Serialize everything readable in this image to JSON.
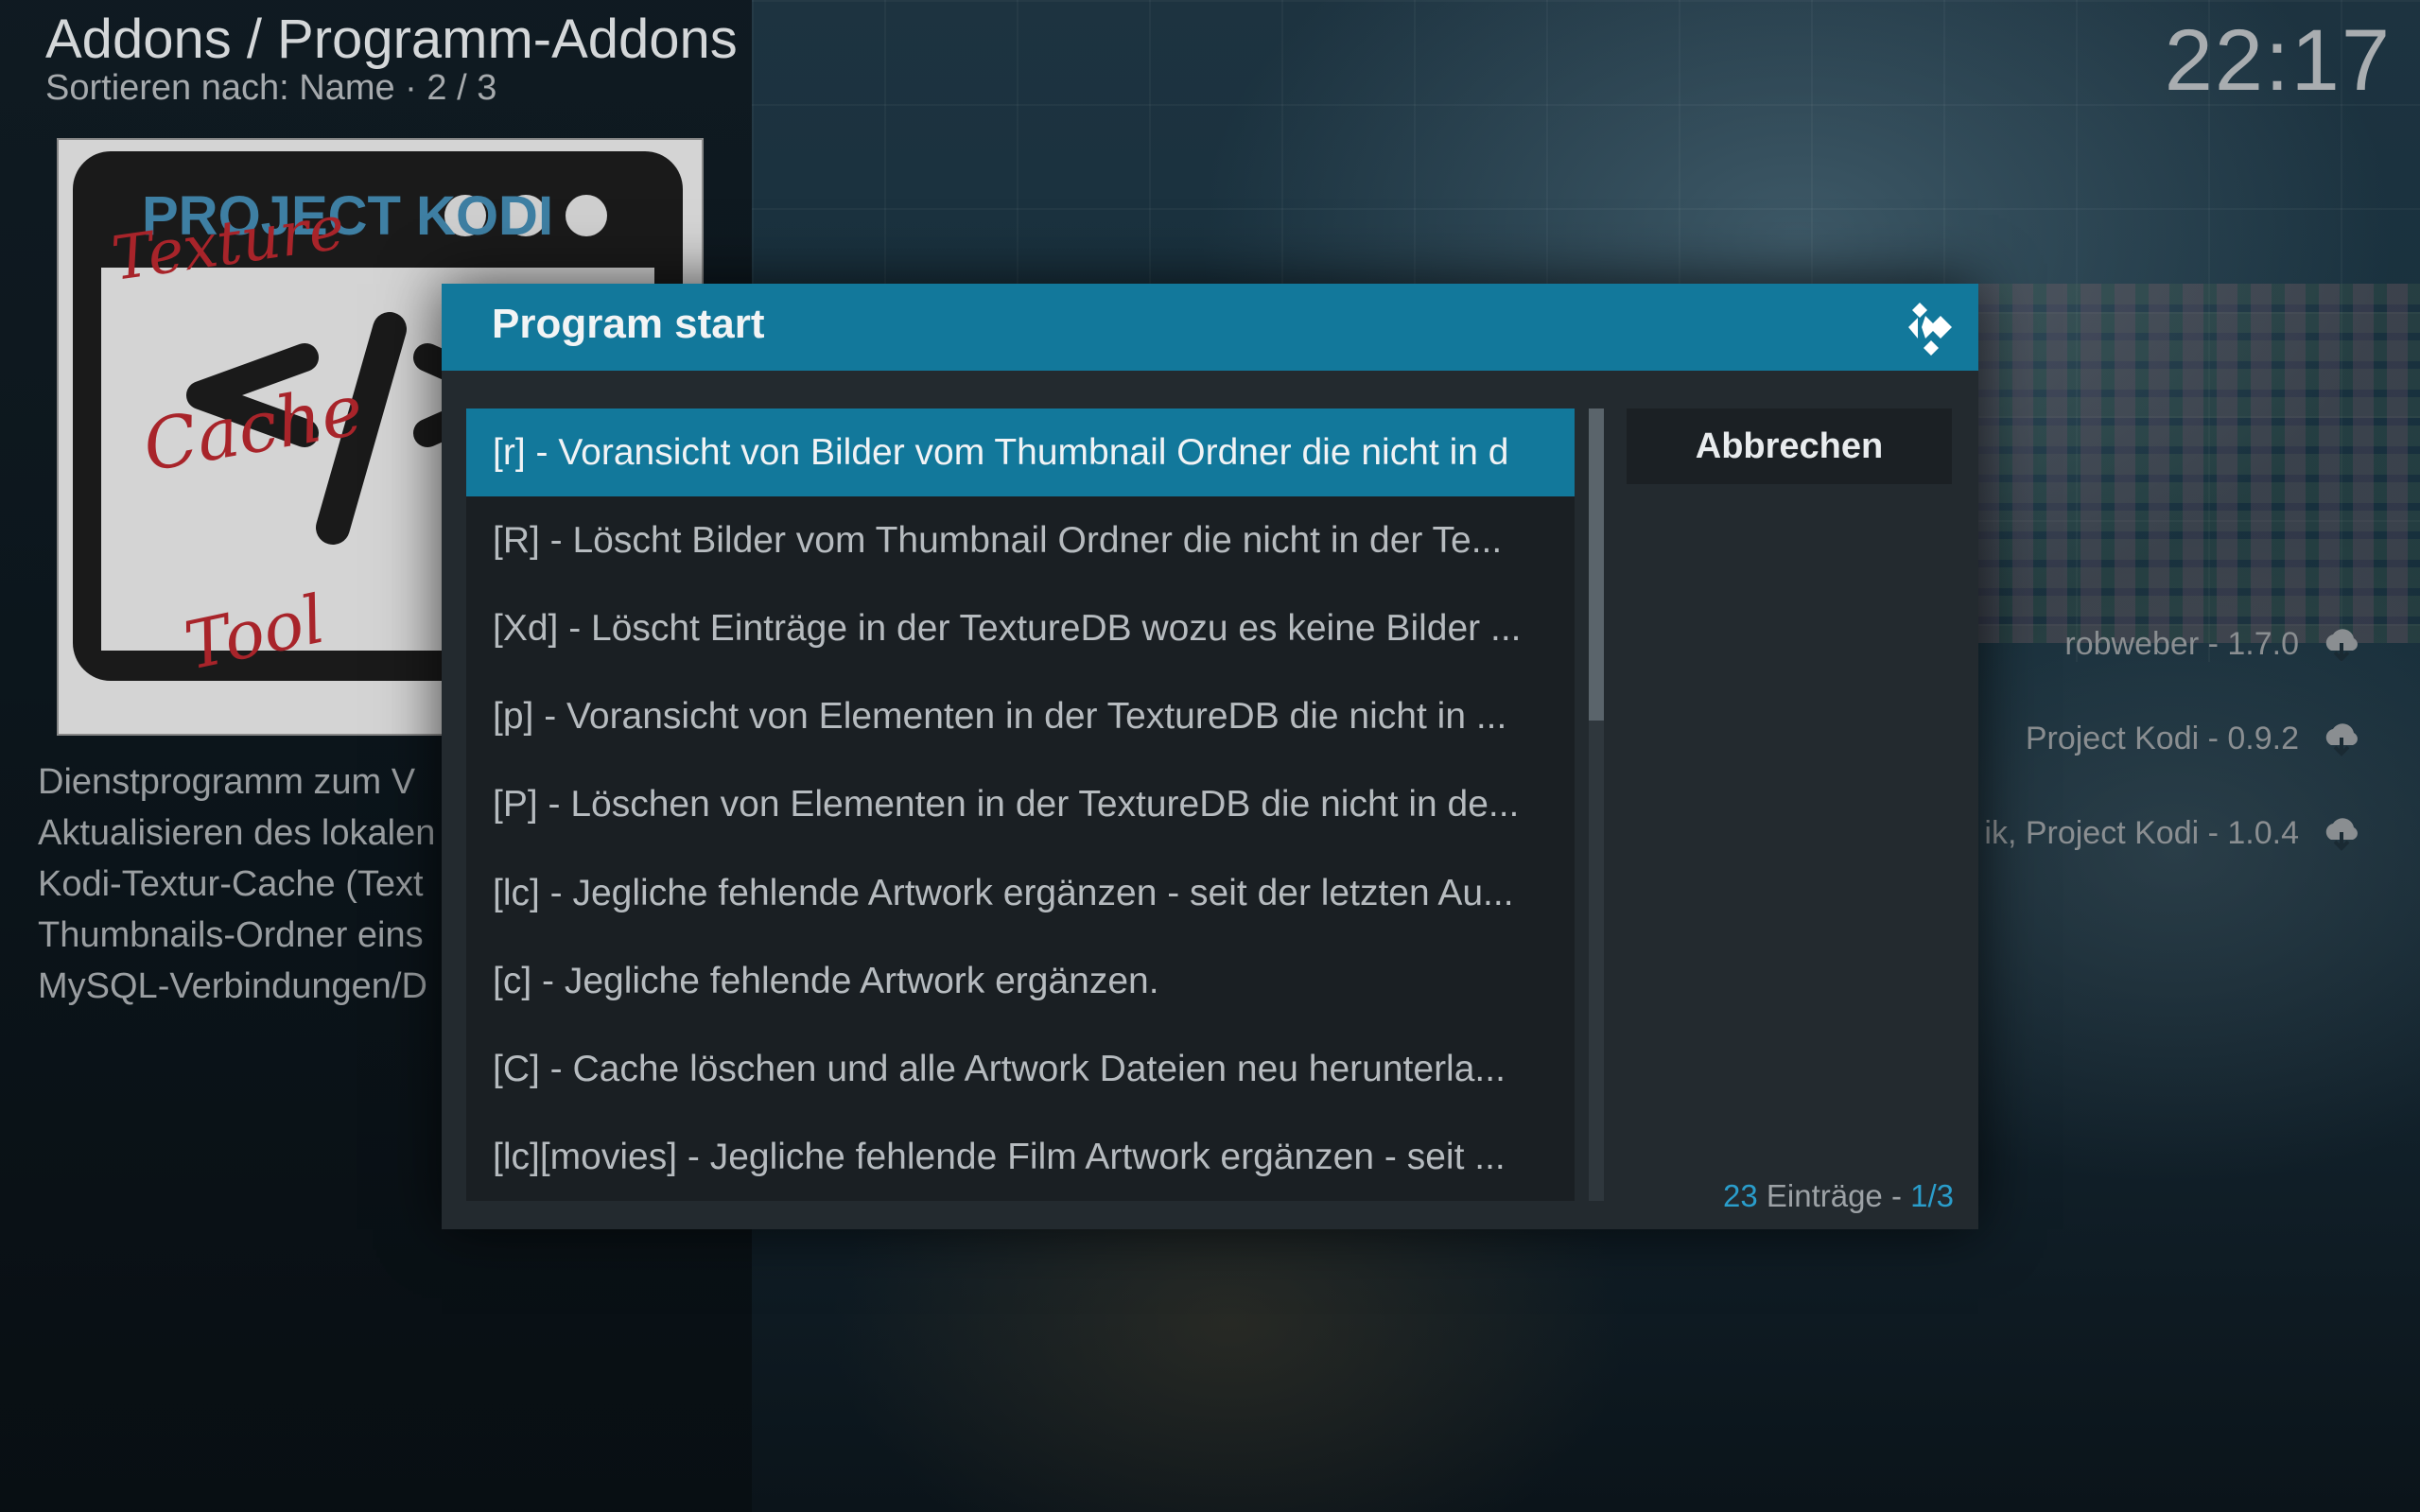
{
  "header": {
    "title": "Addons / Programm-Addons",
    "subtitle": "Sortieren nach: Name  ·  2 / 3",
    "clock": "22:17"
  },
  "addon_thumbnail": {
    "line1": "PROJECT KODI",
    "line2": "Texture",
    "line3": "Cache",
    "line4": "Tool"
  },
  "description": [
    "Dienstprogramm zum V",
    "Aktualisieren des lokalen",
    "Kodi-Textur-Cache (Text",
    "Thumbnails-Ordner eins",
    "MySQL-Verbindungen/D"
  ],
  "background_list": [
    {
      "label": "robweber - 1.7.0",
      "icon": "download-cloud-icon"
    },
    {
      "label": "Project Kodi - 0.9.2",
      "icon": "download-cloud-icon"
    },
    {
      "label": "ik, Project Kodi - 1.0.4",
      "icon": "download-cloud-icon"
    }
  ],
  "dialog": {
    "title": "Program start",
    "cancel_label": "Abbrechen",
    "items": [
      "[r] - Voransicht von Bilder vom Thumbnail Ordner die nicht in d",
      "[R] - Löscht Bilder vom Thumbnail Ordner die nicht in der Te...",
      "[Xd] - Löscht Einträge in der TextureDB wozu es keine Bilder ...",
      "[p] - Voransicht von Elementen in der TextureDB die nicht in ...",
      "[P] - Löschen von Elementen in der TextureDB die nicht in de...",
      "[lc] - Jegliche fehlende Artwork ergänzen - seit der letzten Au...",
      "[c] - Jegliche fehlende Artwork ergänzen.",
      "[C] - Cache löschen und alle Artwork Dateien neu herunterla...",
      "[lc][movies] - Jegliche fehlende Film Artwork ergänzen - seit ..."
    ],
    "selected_index": 0,
    "footer": {
      "count": "23",
      "label": " Einträge - ",
      "page": "1/3"
    }
  },
  "colors": {
    "accent": "#12789b",
    "highlight_text": "#2a9dcb"
  }
}
